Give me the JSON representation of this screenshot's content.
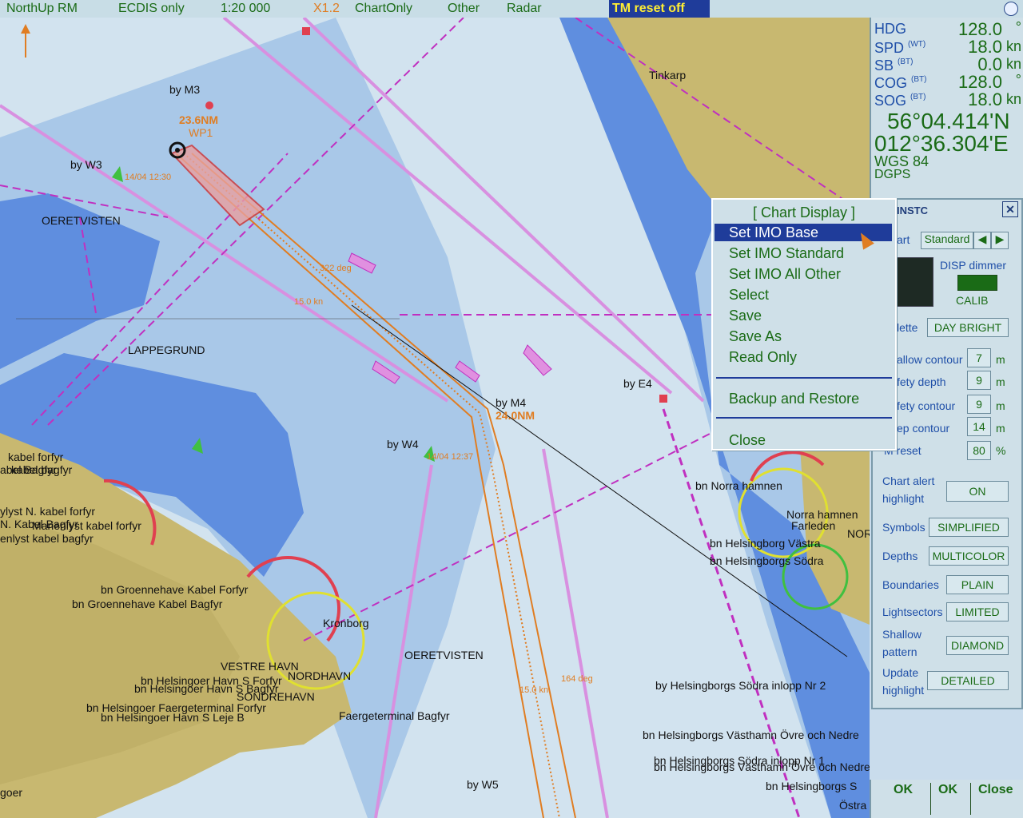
{
  "topbar": {
    "orientation": "NorthUp RM",
    "display_mode": "ECDIS only",
    "scale": "1:20 000",
    "zoom": "X1.2",
    "chart_only": "ChartOnly",
    "other": "Other",
    "radar": "Radar",
    "tm_reset": "TM reset off"
  },
  "nav": {
    "hdg_label": "HDG",
    "hdg_value": "128.0",
    "hdg_unit": "°",
    "spd_label": "SPD",
    "spd_sub": "(WT)",
    "spd_value": "18.0",
    "spd_unit": "kn",
    "sb_label": "SB",
    "sb_sub": "(BT)",
    "sb_value": "0.0",
    "sb_unit": "kn",
    "cog_label": "COG",
    "cog_sub": "(BT)",
    "cog_value": "128.0",
    "cog_unit": "°",
    "sog_label": "SOG",
    "sog_sub": "(BT)",
    "sog_value": "18.0",
    "sog_unit": "kn",
    "lat": "56°04.414'N",
    "lon": "012°36.304'E",
    "datum": "WGS 84",
    "source": "DGPS"
  },
  "panel": {
    "title": "INSTC",
    "tab_chart": "art",
    "tab_standard": "Standard",
    "disp_dimmer": "DISP dimmer",
    "calib": "CALIB",
    "palette_label": "lette",
    "palette_value": "DAY BRIGHT",
    "shallow_contour_label": "allow contour",
    "shallow_contour_value": "7",
    "safety_depth_label": "fety depth",
    "safety_depth_value": "9",
    "safety_contour_label": "fety contour",
    "safety_contour_value": "9",
    "deep_contour_label": "ep contour",
    "deep_contour_value": "14",
    "tm_reset_label": "M reset",
    "tm_reset_value": "80",
    "unit_m": "m",
    "unit_pct": "%",
    "chart_alert_label": "Chart alert",
    "highlight_label": "highlight",
    "chart_alert_value": "ON",
    "symbols_label": "Symbols",
    "symbols_value": "SIMPLIFIED",
    "depths_label": "Depths",
    "depths_value": "MULTICOLOR",
    "boundaries_label": "Boundaries",
    "boundaries_value": "PLAIN",
    "lightsectors_label": "Lightsectors",
    "lightsectors_value": "LIMITED",
    "shallow_pattern_label1": "Shallow",
    "shallow_pattern_label2": "pattern",
    "shallow_pattern_value": "DIAMOND",
    "update_label1": "Update",
    "update_label2": "highlight",
    "update_value": "DETAILED"
  },
  "bottom_buttons": [
    "OK",
    "OK",
    "Close"
  ],
  "menu": {
    "title": "[ Chart Display ]",
    "items": [
      "Set IMO Base",
      "Set IMO Standard",
      "Set IMO All Other",
      "Select",
      "Save",
      "Save As",
      "Read Only"
    ],
    "backup": "Backup and Restore",
    "close": "Close"
  },
  "chart_labels": {
    "tinkarp": "Tinkarp",
    "oeretvisten1": "OERETVISTEN",
    "lappegrund": "LAPPEGRUND",
    "oeretvisten2": "OERETVISTEN",
    "kronborg": "Kronborg",
    "vestre_havn": "VESTRE HAVN",
    "nordhavn": "NORDHAVN",
    "sondrehavn": "SONDREHAVN",
    "by_m3": "by M3",
    "by_w3": "by W3",
    "by_m4": "by M4",
    "by_e4": "by E4",
    "by_w4": "by W4",
    "by_w5": "by W5",
    "wp_dist": "23.6NM",
    "wp_name": "WP1",
    "time1": "14/04 12:30",
    "time2": "14/04 12:37",
    "leg_deg1": "322 deg",
    "leg_kn1": "15.0 kn",
    "leg_deg2": "164 deg",
    "leg_kn2": "15.0 kn",
    "wp2": "24.0NM",
    "goer": "goer",
    "kabel1": "kabel forfyr",
    "kabel2": "kabel bagfyr",
    "kabel3": "abel Bagfyr",
    "kabel4": "ylyst N. kabel forfyr",
    "kabel5": "N. Kabel Bagfyr",
    "kabel6": "Marienlyst kabel forfyr",
    "kabel7": "enlyst kabel bagfyr",
    "groen1": "bn Groennehave Kabel Forfyr",
    "groen2": "bn Groennehave Kabel Bagfyr",
    "helsingoer1": "bn Helsingoer Havn S Forfyr",
    "helsingoer2": "bn Helsingoer Havn S Bagfyr",
    "faerge1": "bn Helsingoer Faergeterminal Forfyr",
    "helsingoer3": "bn Helsingoer Havn S Leje B",
    "faerge2": "Faergeterminal Bagfyr",
    "norra_hamnen": "bn Norra hamnen",
    "norra_hamnen2": "Norra hamnen",
    "farleden": "Farleden",
    "hbg_vastra": "bn Helsingborg Västra",
    "hbg_sodra1": "bn Helsingborgs Södra",
    "hbg_sodra_nr2": "by Helsingborgs Södra inlopp Nr 2",
    "hbg_vasthamn": "bn Helsingborgs Västhamn Övre och Nedre",
    "hbg_sodra_nr1": "bn Helsingborgs Södra inlopp Nr 1",
    "hbg_vasthamn2": "bn Helsingborgs Västhamn Övre och Nedre",
    "hbg_sodra3": "bn Helsingborgs S",
    "ostra": "Östra",
    "nor": "NOR",
    "colors": {
      "deep": "#d2e3ef",
      "medium": "#a9c8e8",
      "shallow": "#5f8edf",
      "land": "#c8b870",
      "land_dark": "#b8a860",
      "route": "#e07d22",
      "lane": "#d890e0",
      "boundary": "#c030c0"
    }
  }
}
